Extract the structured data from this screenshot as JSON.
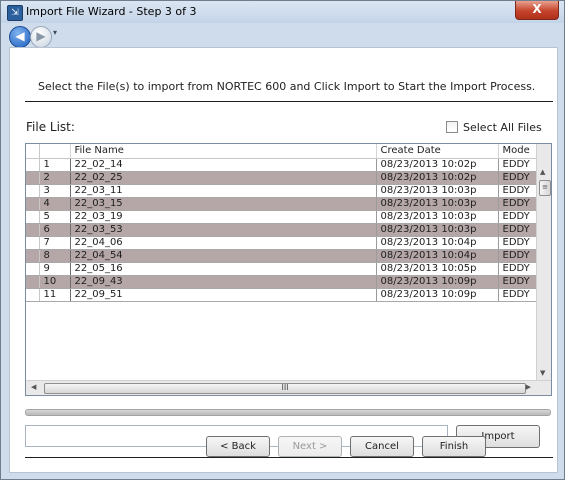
{
  "window": {
    "title": "Import File Wizard - Step 3 of 3",
    "close_label": "X",
    "app_icon_label": "⇲"
  },
  "nav": {
    "back_glyph": "◀",
    "forward_glyph": "▶",
    "dropdown_glyph": "▾"
  },
  "instruction": "Select the File(s) to import from NORTEC 600 and Click Import to Start the Import Process.",
  "file_list": {
    "label": "File List:",
    "select_all_label": "Select All Files",
    "select_all_checked": false,
    "columns": [
      "",
      "File Name",
      "Create Date",
      "Mode"
    ],
    "rows": [
      {
        "index": "1",
        "name": "22_02_14",
        "date": "08/23/2013 10:02p",
        "mode": "EDDY"
      },
      {
        "index": "2",
        "name": "22_02_25",
        "date": "08/23/2013 10:02p",
        "mode": "EDDY"
      },
      {
        "index": "3",
        "name": "22_03_11",
        "date": "08/23/2013 10:03p",
        "mode": "EDDY"
      },
      {
        "index": "4",
        "name": "22_03_15",
        "date": "08/23/2013 10:03p",
        "mode": "EDDY"
      },
      {
        "index": "5",
        "name": "22_03_19",
        "date": "08/23/2013 10:03p",
        "mode": "EDDY"
      },
      {
        "index": "6",
        "name": "22_03_53",
        "date": "08/23/2013 10:03p",
        "mode": "EDDY"
      },
      {
        "index": "7",
        "name": "22_04_06",
        "date": "08/23/2013 10:04p",
        "mode": "EDDY"
      },
      {
        "index": "8",
        "name": "22_04_54",
        "date": "08/23/2013 10:04p",
        "mode": "EDDY"
      },
      {
        "index": "9",
        "name": "22_05_16",
        "date": "08/23/2013 10:05p",
        "mode": "EDDY"
      },
      {
        "index": "10",
        "name": "22_09_43",
        "date": "08/23/2013 10:09p",
        "mode": "EDDY"
      },
      {
        "index": "11",
        "name": "22_09_51",
        "date": "08/23/2013 10:09p",
        "mode": "EDDY"
      }
    ],
    "colors": {
      "alt_row": "#b5a7a7",
      "row": "#ffffff"
    },
    "hscroll_grip": "III"
  },
  "status": {
    "value": ""
  },
  "buttons": {
    "import": "Import",
    "back": "< Back",
    "next": "Next >",
    "cancel": "Cancel",
    "finish": "Finish"
  }
}
